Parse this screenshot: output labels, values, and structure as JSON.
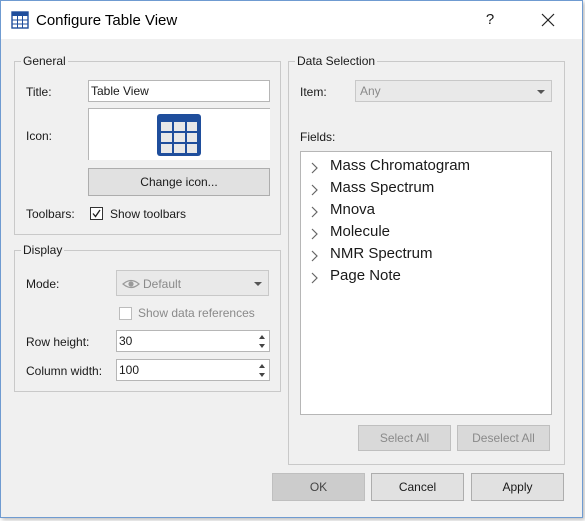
{
  "window": {
    "title": "Configure Table View",
    "help_label": "?"
  },
  "general": {
    "legend": "General",
    "title_label": "Title:",
    "title_value": "Table View",
    "icon_label": "Icon:",
    "change_icon_label": "Change icon...",
    "toolbars_label": "Toolbars:",
    "show_toolbars_label": "Show toolbars",
    "show_toolbars_checked": true
  },
  "display": {
    "legend": "Display",
    "mode_label": "Mode:",
    "mode_value": "Default",
    "show_data_refs_label": "Show data references",
    "show_data_refs_checked": false,
    "row_height_label": "Row height:",
    "row_height_value": "30",
    "column_width_label": "Column width:",
    "column_width_value": "100"
  },
  "data_selection": {
    "legend": "Data Selection",
    "item_label": "Item:",
    "item_value": "Any",
    "fields_label": "Fields:",
    "fields": [
      {
        "label": "Mass Chromatogram"
      },
      {
        "label": "Mass Spectrum"
      },
      {
        "label": "Mnova"
      },
      {
        "label": "Molecule"
      },
      {
        "label": "NMR Spectrum"
      },
      {
        "label": "Page Note"
      }
    ],
    "select_all_label": "Select All",
    "deselect_all_label": "Deselect All"
  },
  "footer": {
    "ok_label": "OK",
    "cancel_label": "Cancel",
    "apply_label": "Apply"
  },
  "colors": {
    "icon_blue": "#1f4e9c",
    "border_accent": "#6f9bd1"
  }
}
